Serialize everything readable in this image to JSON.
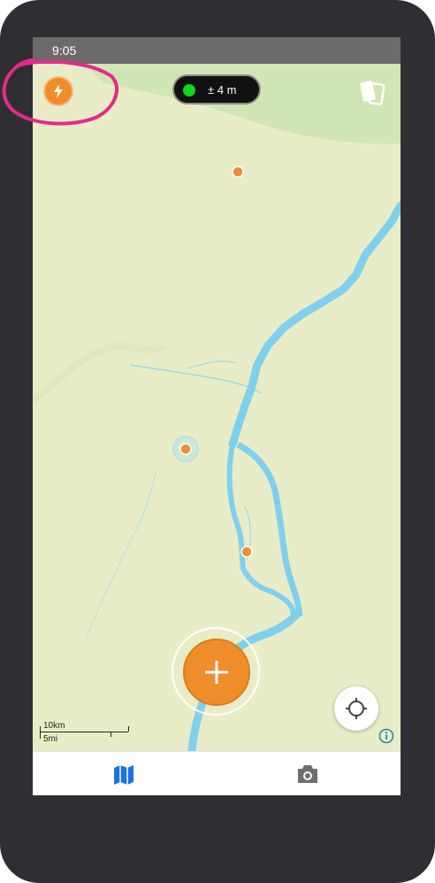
{
  "status_bar": {
    "time": "9:05"
  },
  "gps": {
    "accuracy": "± 4 m",
    "status_color": "#12d61a"
  },
  "icons": {
    "power": "lightning-bolt-icon",
    "layers": "map-layers-icon",
    "add": "plus-icon",
    "locate": "crosshair-locate-icon",
    "info": "info-icon",
    "map_tab": "map-icon",
    "camera_tab": "camera-icon"
  },
  "scale_bar": {
    "metric": "10km",
    "imperial": "5mi"
  },
  "map": {
    "land_color": "#e8edc7",
    "forest_color": "#d1e6b5",
    "water_color": "#7fd0ee",
    "marker_color": "#ef8d39"
  },
  "accent_color": "#f08d2b",
  "active_tab_color": "#1a73e8",
  "annotation_color": "#e8288c"
}
